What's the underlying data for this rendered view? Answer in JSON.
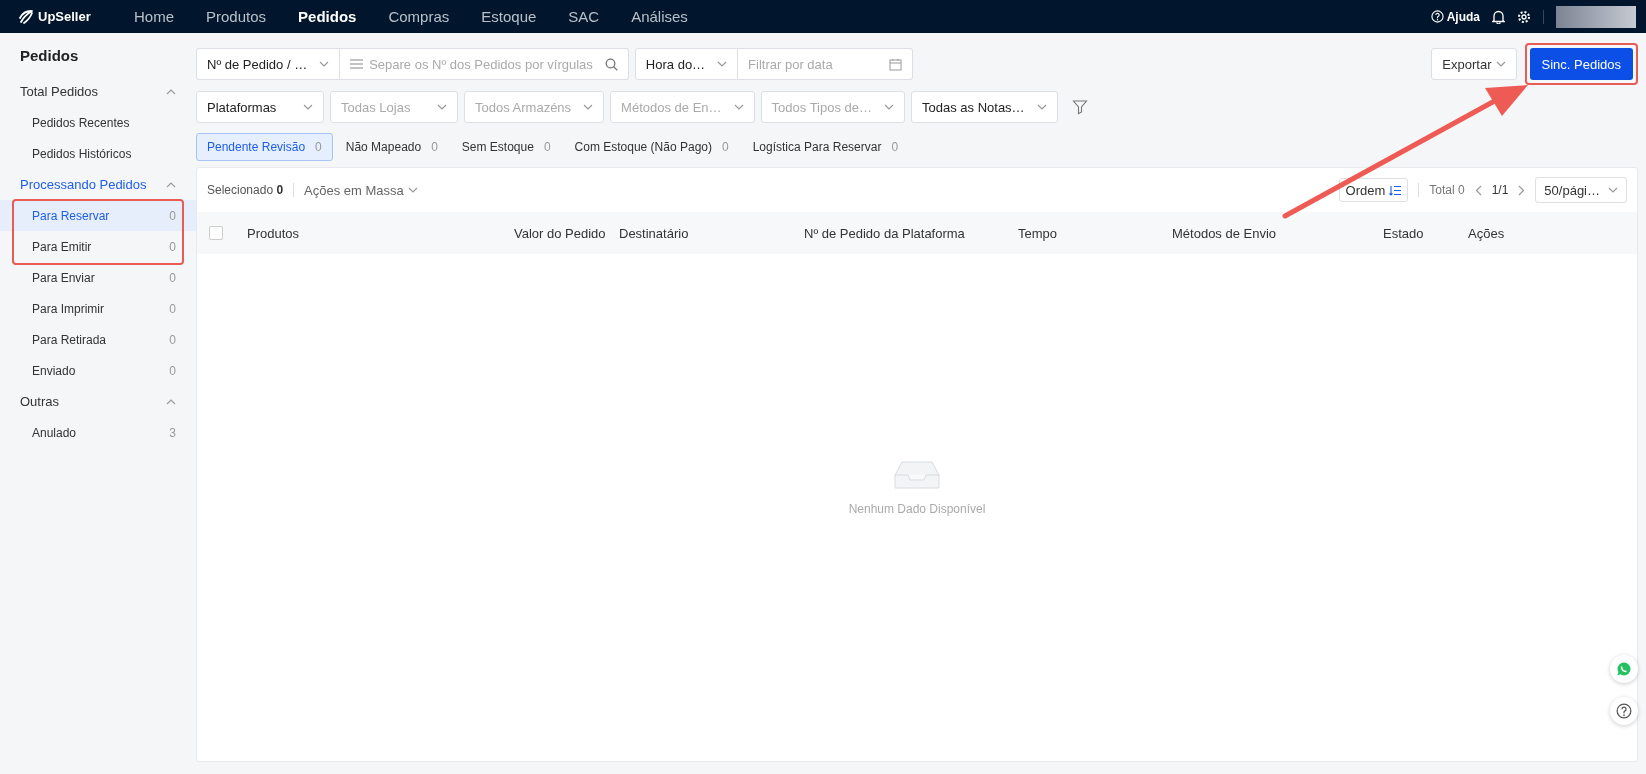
{
  "brand": "UpSeller",
  "nav": [
    {
      "label": "Home",
      "selected": false
    },
    {
      "label": "Produtos",
      "selected": false
    },
    {
      "label": "Pedidos",
      "selected": true
    },
    {
      "label": "Compras",
      "selected": false
    },
    {
      "label": "Estoque",
      "selected": false
    },
    {
      "label": "SAC",
      "selected": false
    },
    {
      "label": "Análises",
      "selected": false
    }
  ],
  "header_right": {
    "help": "Ajuda"
  },
  "sidebar": {
    "title": "Pedidos",
    "groups": [
      {
        "label": "Total Pedidos",
        "expanded": true,
        "selected": false,
        "items": [
          {
            "label": "Pedidos Recentes",
            "selected": false
          },
          {
            "label": "Pedidos Históricos",
            "selected": false
          }
        ]
      },
      {
        "label": "Processando Pedidos",
        "expanded": true,
        "selected": true,
        "items": [
          {
            "label": "Para Reservar",
            "count": "0",
            "selected": true
          },
          {
            "label": "Para Emitir",
            "count": "0",
            "selected": false
          },
          {
            "label": "Para Enviar",
            "count": "0",
            "selected": false
          },
          {
            "label": "Para Imprimir",
            "count": "0",
            "selected": false
          },
          {
            "label": "Para Retirada",
            "count": "0",
            "selected": false
          },
          {
            "label": "Enviado",
            "count": "0",
            "selected": false
          }
        ]
      },
      {
        "label": "Outras",
        "expanded": true,
        "selected": false,
        "items": [
          {
            "label": "Anulado",
            "count": "3",
            "selected": false
          }
        ]
      }
    ]
  },
  "filters": {
    "row_1": [
      {
        "kind": "select",
        "value": "Nº de Pedido / …"
      },
      {
        "kind": "search",
        "placeholder": "Separe os Nº dos Pedidos por vírgulas"
      },
      {
        "kind": "select",
        "value": "Hora do…"
      },
      {
        "kind": "date",
        "placeholder": "Filtrar por data"
      }
    ],
    "row_2": [
      {
        "kind": "select",
        "value": "Plataformas"
      },
      {
        "kind": "select",
        "placeholder": "Todas Lojas"
      },
      {
        "kind": "select",
        "placeholder": "Todos Armazéns"
      },
      {
        "kind": "select",
        "placeholder": "Métodos de En…"
      },
      {
        "kind": "select",
        "placeholder": "Todos Tipos de…"
      },
      {
        "kind": "select",
        "value": "Todas as Notas…"
      }
    ]
  },
  "actions": {
    "export": "Exportar",
    "sync": "Sinc. Pedidos"
  },
  "status_tabs": [
    {
      "label": "Pendente Revisão",
      "count": "0",
      "selected": true
    },
    {
      "label": "Não Mapeado",
      "count": "0",
      "selected": false
    },
    {
      "label": "Sem Estoque",
      "count": "0",
      "selected": false
    },
    {
      "label": "Com Estoque (Não Pago)",
      "count": "0",
      "selected": false
    },
    {
      "label": "Logística Para Reservar",
      "count": "0",
      "selected": false
    }
  ],
  "table": {
    "select_all_checked": false,
    "selected_label": "Selecionado",
    "selected_count": "0",
    "bulk_actions": "Ações em Massa",
    "sort": "Ordem",
    "total": "Total 0",
    "page": "1/1",
    "page_size": "50/pági…",
    "columns": [
      "Produtos",
      "Valor do Pedido",
      "Destinatário",
      "Nº de Pedido da Plataforma",
      "Tempo",
      "Métodos de Envio",
      "Estado",
      "Ações"
    ],
    "empty_text": "Nenhum Dado Disponível"
  }
}
